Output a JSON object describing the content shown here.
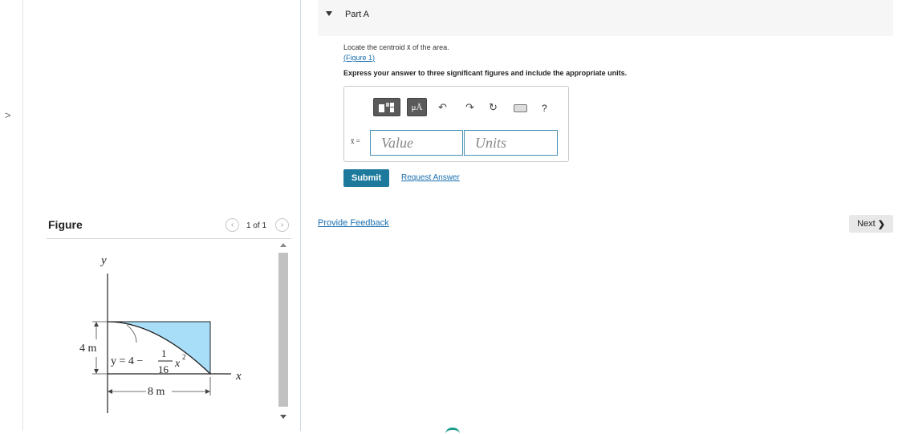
{
  "figure_panel": {
    "title": "Figure",
    "pager": "1 of 1",
    "prev_icon": "‹",
    "next_icon": "›",
    "figure": {
      "y_axis_label": "y",
      "x_axis_label": "x",
      "height_label": "4 m",
      "width_label": "8 m",
      "equation_lhs": "y = 4 −",
      "equation_num": "1",
      "equation_den": "16",
      "equation_var": "x",
      "equation_exp": "2",
      "fill_color": "#a8def7"
    }
  },
  "part": {
    "title": "Part A",
    "problem_text": "Locate the centroid x̄ of the area.",
    "figure_link": "(Figure 1)",
    "instructions": "Express your answer to three significant figures and include the appropriate units."
  },
  "toolbar": {
    "units_label": "μÅ",
    "undo_icon": "↶",
    "redo_icon": "↷",
    "reset_icon": "↻",
    "help_label": "?"
  },
  "answer": {
    "variable_label": "x̄ =",
    "value_placeholder": "Value",
    "units_placeholder": "Units"
  },
  "actions": {
    "submit_label": "Submit",
    "request_answer_label": "Request Answer",
    "provide_feedback_label": "Provide Feedback",
    "next_label": "Next",
    "next_icon": "❯"
  },
  "left_strip": {
    "collapse_icon": ">"
  },
  "colors": {
    "accent": "#1d7a9c",
    "link": "#1a6fb0",
    "input_border": "#4a90b8"
  }
}
